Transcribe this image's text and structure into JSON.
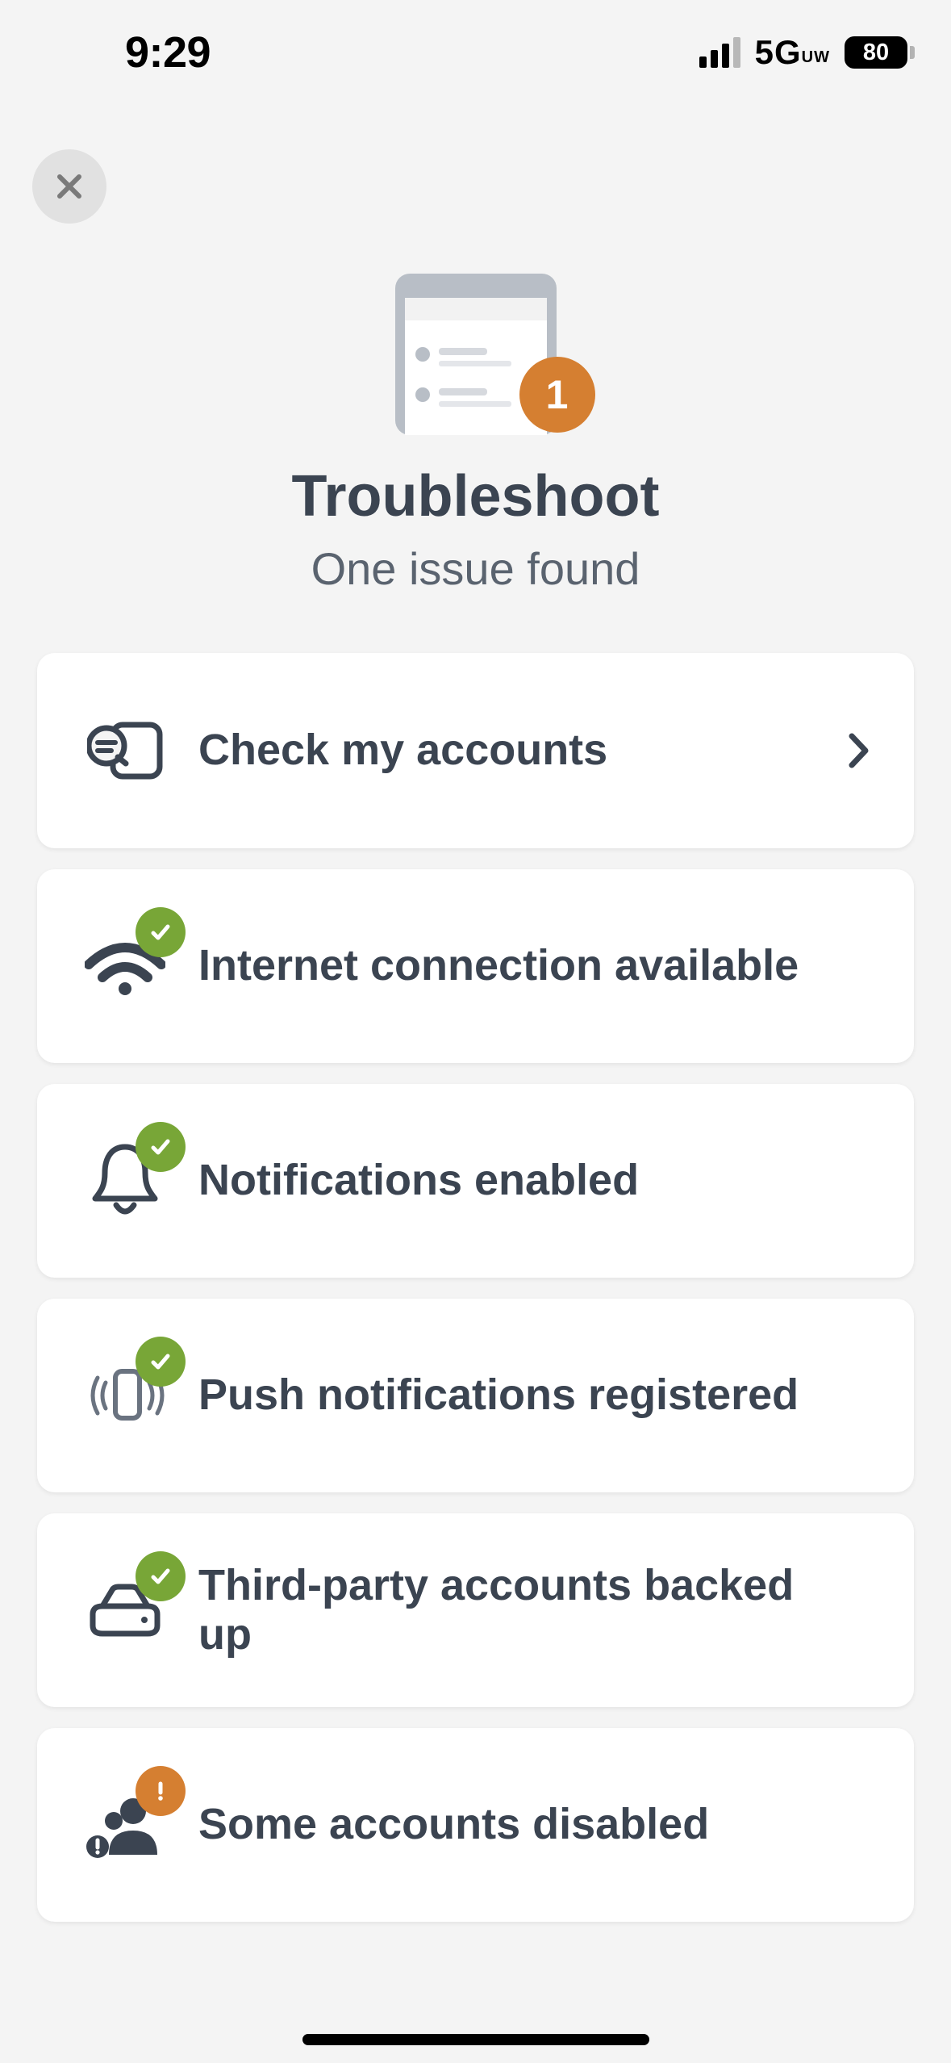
{
  "statusbar": {
    "time": "9:29",
    "network": "5G",
    "network_sub": "UW",
    "battery": "80"
  },
  "hero": {
    "title": "Troubleshoot",
    "subtitle": "One issue found",
    "badge_count": "1"
  },
  "items": [
    {
      "label": "Check my accounts"
    },
    {
      "label": "Internet connection available"
    },
    {
      "label": "Notifications enabled"
    },
    {
      "label": "Push notifications registered"
    },
    {
      "label": "Third-party accounts backed up"
    },
    {
      "label": "Some accounts disabled"
    }
  ]
}
